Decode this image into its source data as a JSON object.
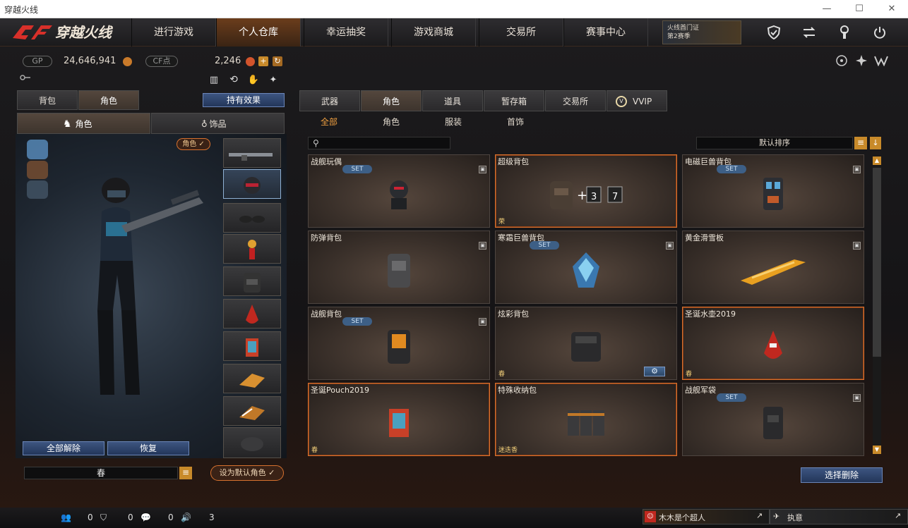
{
  "window": {
    "title": "穿越火线",
    "controls": [
      "—",
      "☐",
      "✕"
    ]
  },
  "nav": {
    "logo": "穿越火线",
    "tabs": [
      "进行游戏",
      "个人仓库",
      "幸运抽奖",
      "游戏商城",
      "交易所",
      "赛事中心"
    ],
    "active_tab": "个人仓库",
    "promo_line1": "火线酋门证",
    "promo_line2": "第2赛季"
  },
  "currency": {
    "gp_label": "GP",
    "gp_value": "24,646,941",
    "cf_label": "CF点",
    "cf_value": "2,246"
  },
  "left": {
    "tabs": [
      "背包",
      "角色"
    ],
    "active_tab": "角色",
    "holding_effect": "持有效果",
    "subtabs": [
      "角色",
      "饰品"
    ],
    "role_badge": "角色 ✓",
    "unequip_all": "全部解除",
    "restore": "恢复",
    "preset_value": "春",
    "set_default": "设为默认角色 ✓"
  },
  "right": {
    "tabs": [
      "武器",
      "角色",
      "道具",
      "暂存箱",
      "交易所",
      "VVIP"
    ],
    "active_tab": "角色",
    "subtabs": [
      "全部",
      "角色",
      "服装",
      "首饰"
    ],
    "active_subtab": "全部",
    "sort_label": "默认排序",
    "delete_button": "选择删除",
    "items": [
      {
        "name": "战舰玩偶",
        "set": "SET",
        "tag": ""
      },
      {
        "name": "超级背包",
        "set": "",
        "tag": "荣",
        "extra": "3 7"
      },
      {
        "name": "电磁巨兽背包",
        "set": "SET",
        "tag": ""
      },
      {
        "name": "防弹背包",
        "set": "",
        "tag": ""
      },
      {
        "name": "寒霜巨兽背包",
        "set": "SET",
        "tag": ""
      },
      {
        "name": "黄金滑雪板",
        "set": "",
        "tag": ""
      },
      {
        "name": "战舰背包",
        "set": "SET",
        "tag": ""
      },
      {
        "name": "炫彩背包",
        "set": "",
        "tag": "春"
      },
      {
        "name": "圣诞水壶2019",
        "set": "",
        "tag": "春"
      },
      {
        "name": "圣诞Pouch2019",
        "set": "",
        "tag": "春"
      },
      {
        "name": "特殊收纳包",
        "set": "",
        "tag": "迷迭香"
      },
      {
        "name": "战舰军袋",
        "set": "SET",
        "tag": ""
      }
    ]
  },
  "status": {
    "players": "0",
    "shield": "0",
    "chat": "0",
    "volume": "3",
    "user1": "木木是个超人",
    "user2": "执意"
  },
  "colors": {
    "accent": "#d8722f",
    "tag_gold": "#f6d27a",
    "set_blue": "#3d5f86"
  }
}
